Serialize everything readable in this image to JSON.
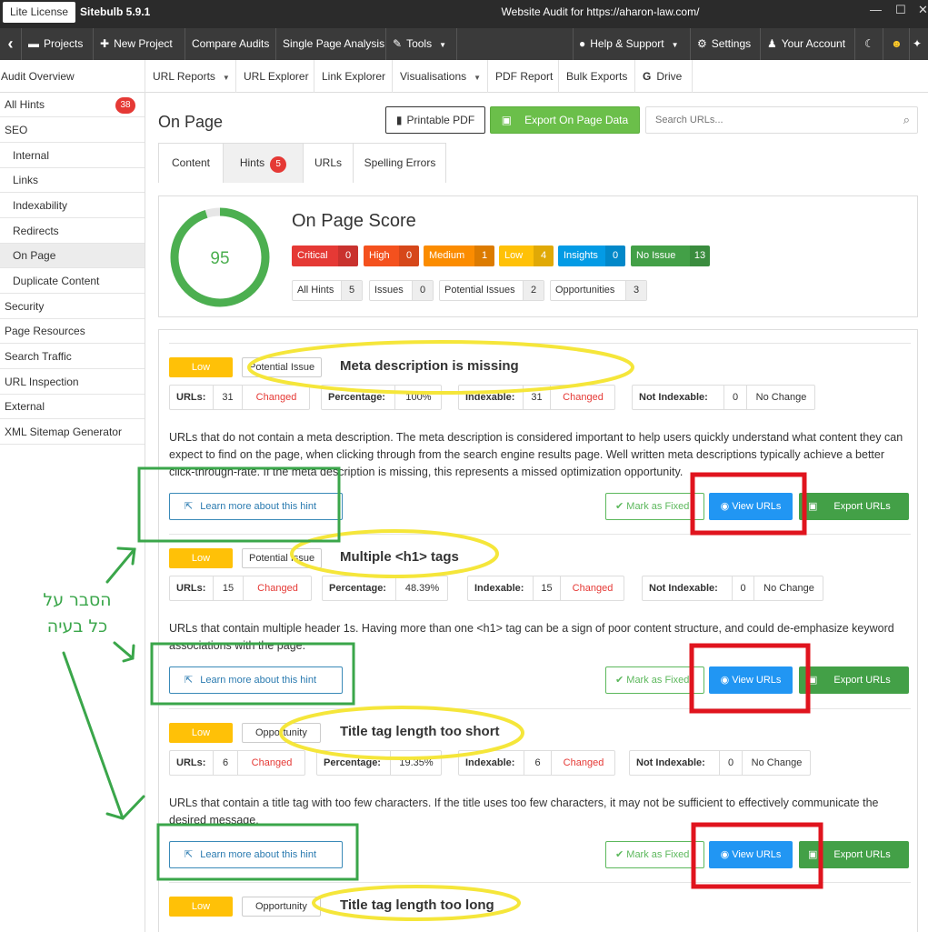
{
  "titlebar": {
    "license": "Lite License",
    "version": "Sitebulb 5.9.1",
    "window_title": "Website Audit for https://aharon-law.com/"
  },
  "nav": {
    "back": "‹",
    "projects": "Projects",
    "new_project": "New Project",
    "compare_audits": "Compare Audits",
    "single_page": "Single Page Analysis",
    "tools": "Tools",
    "help": "Help & Support",
    "settings": "Settings",
    "account": "Your Account"
  },
  "subnav": {
    "audit_overview": "Audit Overview",
    "url_reports": "URL Reports",
    "url_explorer": "URL Explorer",
    "link_explorer": "Link Explorer",
    "visualisations": "Visualisations",
    "pdf_report": "PDF Report",
    "bulk_exports": "Bulk Exports",
    "drive": "Drive"
  },
  "sidebar": {
    "items": [
      {
        "label": "All Hints",
        "badge": "38"
      },
      {
        "label": "SEO"
      },
      {
        "label": "Internal"
      },
      {
        "label": "Links"
      },
      {
        "label": "Indexability"
      },
      {
        "label": "Redirects"
      },
      {
        "label": "On Page"
      },
      {
        "label": "Duplicate Content"
      },
      {
        "label": "Security"
      },
      {
        "label": "Page Resources"
      },
      {
        "label": "Search Traffic"
      },
      {
        "label": "URL Inspection"
      },
      {
        "label": "External"
      },
      {
        "label": "XML Sitemap Generator"
      }
    ]
  },
  "main": {
    "title": "On Page",
    "printable_pdf": "Printable PDF",
    "export_data": "Export On Page Data",
    "search_placeholder": "Search URLs...",
    "tabs": [
      {
        "label": "Content"
      },
      {
        "label": "Hints",
        "badge": "5"
      },
      {
        "label": "URLs"
      },
      {
        "label": "Spelling Errors"
      }
    ]
  },
  "score": {
    "value": "95",
    "fraction": 0.95,
    "title": "On Page Score",
    "severity": [
      {
        "label": "Critical",
        "count": "0",
        "color": "#e53935"
      },
      {
        "label": "High",
        "count": "0",
        "color": "#f4511e"
      },
      {
        "label": "Medium",
        "count": "1",
        "color": "#fb8c00"
      },
      {
        "label": "Low",
        "count": "4",
        "color": "#ffc107"
      },
      {
        "label": "Insights",
        "count": "0",
        "color": "#039be5"
      },
      {
        "label": "No Issue",
        "count": "13",
        "color": "#43a047"
      }
    ],
    "types": [
      {
        "label": "All Hints",
        "count": "5"
      },
      {
        "label": "Issues",
        "count": "0"
      },
      {
        "label": "Potential Issues",
        "count": "2"
      },
      {
        "label": "Opportunities",
        "count": "3"
      }
    ]
  },
  "labels": {
    "urls": "URLs:",
    "percentage": "Percentage:",
    "indexable": "Indexable:",
    "not_indexable": "Not Indexable:",
    "changed": "Changed",
    "no_change": "No Change",
    "learn_more": "Learn more about this hint",
    "mark_fixed": "Mark as Fixed",
    "view_urls": "View URLs",
    "export_urls": "Export URLs"
  },
  "hints": [
    {
      "priority": "Low",
      "type": "Potential Issue",
      "title": "Meta description is missing",
      "urls": "31",
      "percentage": "100%",
      "indexable": "31",
      "not_indexable": "0",
      "description": "URLs that do not contain a meta description. The meta description is considered important to help users quickly understand what content they can expect to find on the page, when clicking through from the search engine results page. Well written meta descriptions typically achieve a better click-through-rate. If the meta description is missing, this represents a missed optimization opportunity."
    },
    {
      "priority": "Low",
      "type": "Potential Issue",
      "title": "Multiple <h1> tags",
      "urls": "15",
      "percentage": "48.39%",
      "indexable": "15",
      "not_indexable": "0",
      "description": "URLs that contain multiple header 1s. Having more than one <h1> tag can be a sign of poor content structure, and could de-emphasize keyword associations with the page."
    },
    {
      "priority": "Low",
      "type": "Opportunity",
      "title": "Title tag length too short",
      "urls": "6",
      "percentage": "19.35%",
      "indexable": "6",
      "not_indexable": "0",
      "description": "URLs that contain a title tag with too few characters. If the title uses too few characters, it may not be sufficient to effectively communicate the desired message."
    },
    {
      "priority": "Low",
      "type": "Opportunity",
      "title": "Title tag length too long"
    }
  ],
  "annotation": {
    "line1": "הסבר על",
    "line2": "כל בעיה",
    "yellow": "#f5e63a",
    "red": "#e0141e",
    "green": "#3aa64a"
  }
}
